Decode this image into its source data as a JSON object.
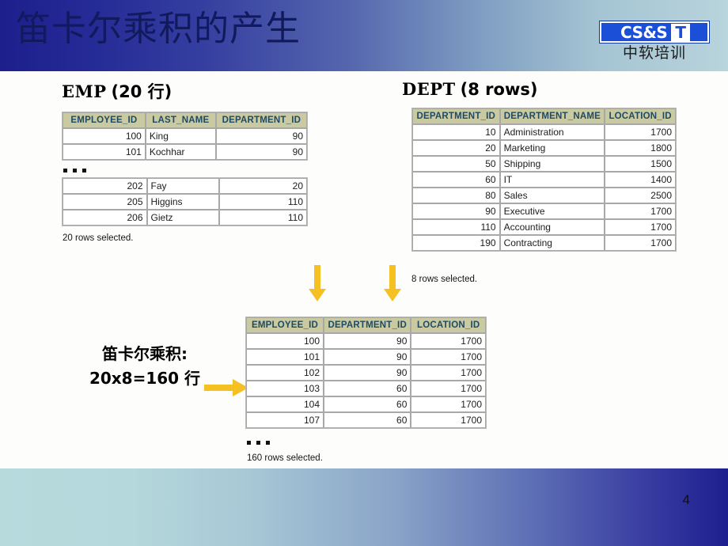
{
  "slide": {
    "title": "笛卡尔乘积的产生",
    "page_number": "4",
    "accent_header_dark": "#1c1f8c",
    "accent_header_light": "#b8d4dc",
    "table_header_bg": "#c9c9a2",
    "table_header_fg": "#1f4a63",
    "arrow_color": "#f5c021"
  },
  "logo": {
    "mark": "CS&S",
    "badge": "T",
    "subtitle": "中软培训"
  },
  "emp": {
    "title_mono": "EMP",
    "title_plain": "(20 行)",
    "columns": [
      "EMPLOYEE_ID",
      "LAST_NAME",
      "DEPARTMENT_ID"
    ],
    "rows_top": [
      [
        "100",
        "King",
        "90"
      ],
      [
        "101",
        "Kochhar",
        "90"
      ]
    ],
    "rows_bottom": [
      [
        "202",
        "Fay",
        "20"
      ],
      [
        "205",
        "Higgins",
        "110"
      ],
      [
        "206",
        "Gietz",
        "110"
      ]
    ],
    "ellipsis": "...",
    "footer": "20 rows selected."
  },
  "dept": {
    "title_mono": "DEPT",
    "title_plain": "(8 rows)",
    "columns": [
      "DEPARTMENT_ID",
      "DEPARTMENT_NAME",
      "LOCATION_ID"
    ],
    "rows": [
      [
        "10",
        "Administration",
        "1700"
      ],
      [
        "20",
        "Marketing",
        "1800"
      ],
      [
        "50",
        "Shipping",
        "1500"
      ],
      [
        "60",
        "IT",
        "1400"
      ],
      [
        "80",
        "Sales",
        "2500"
      ],
      [
        "90",
        "Executive",
        "1700"
      ],
      [
        "110",
        "Accounting",
        "1700"
      ],
      [
        "190",
        "Contracting",
        "1700"
      ]
    ],
    "footer": "8 rows selected."
  },
  "result": {
    "columns": [
      "EMPLOYEE_ID",
      "DEPARTMENT_ID",
      "LOCATION_ID"
    ],
    "rows": [
      [
        "100",
        "90",
        "1700"
      ],
      [
        "101",
        "90",
        "1700"
      ],
      [
        "102",
        "90",
        "1700"
      ],
      [
        "103",
        "60",
        "1700"
      ],
      [
        "104",
        "60",
        "1700"
      ],
      [
        "107",
        "60",
        "1700"
      ]
    ],
    "ellipsis": "...",
    "footer": "160 rows selected."
  },
  "product_label": {
    "line1": "笛卡尔乘积:",
    "line2": "20x8=160 行"
  }
}
